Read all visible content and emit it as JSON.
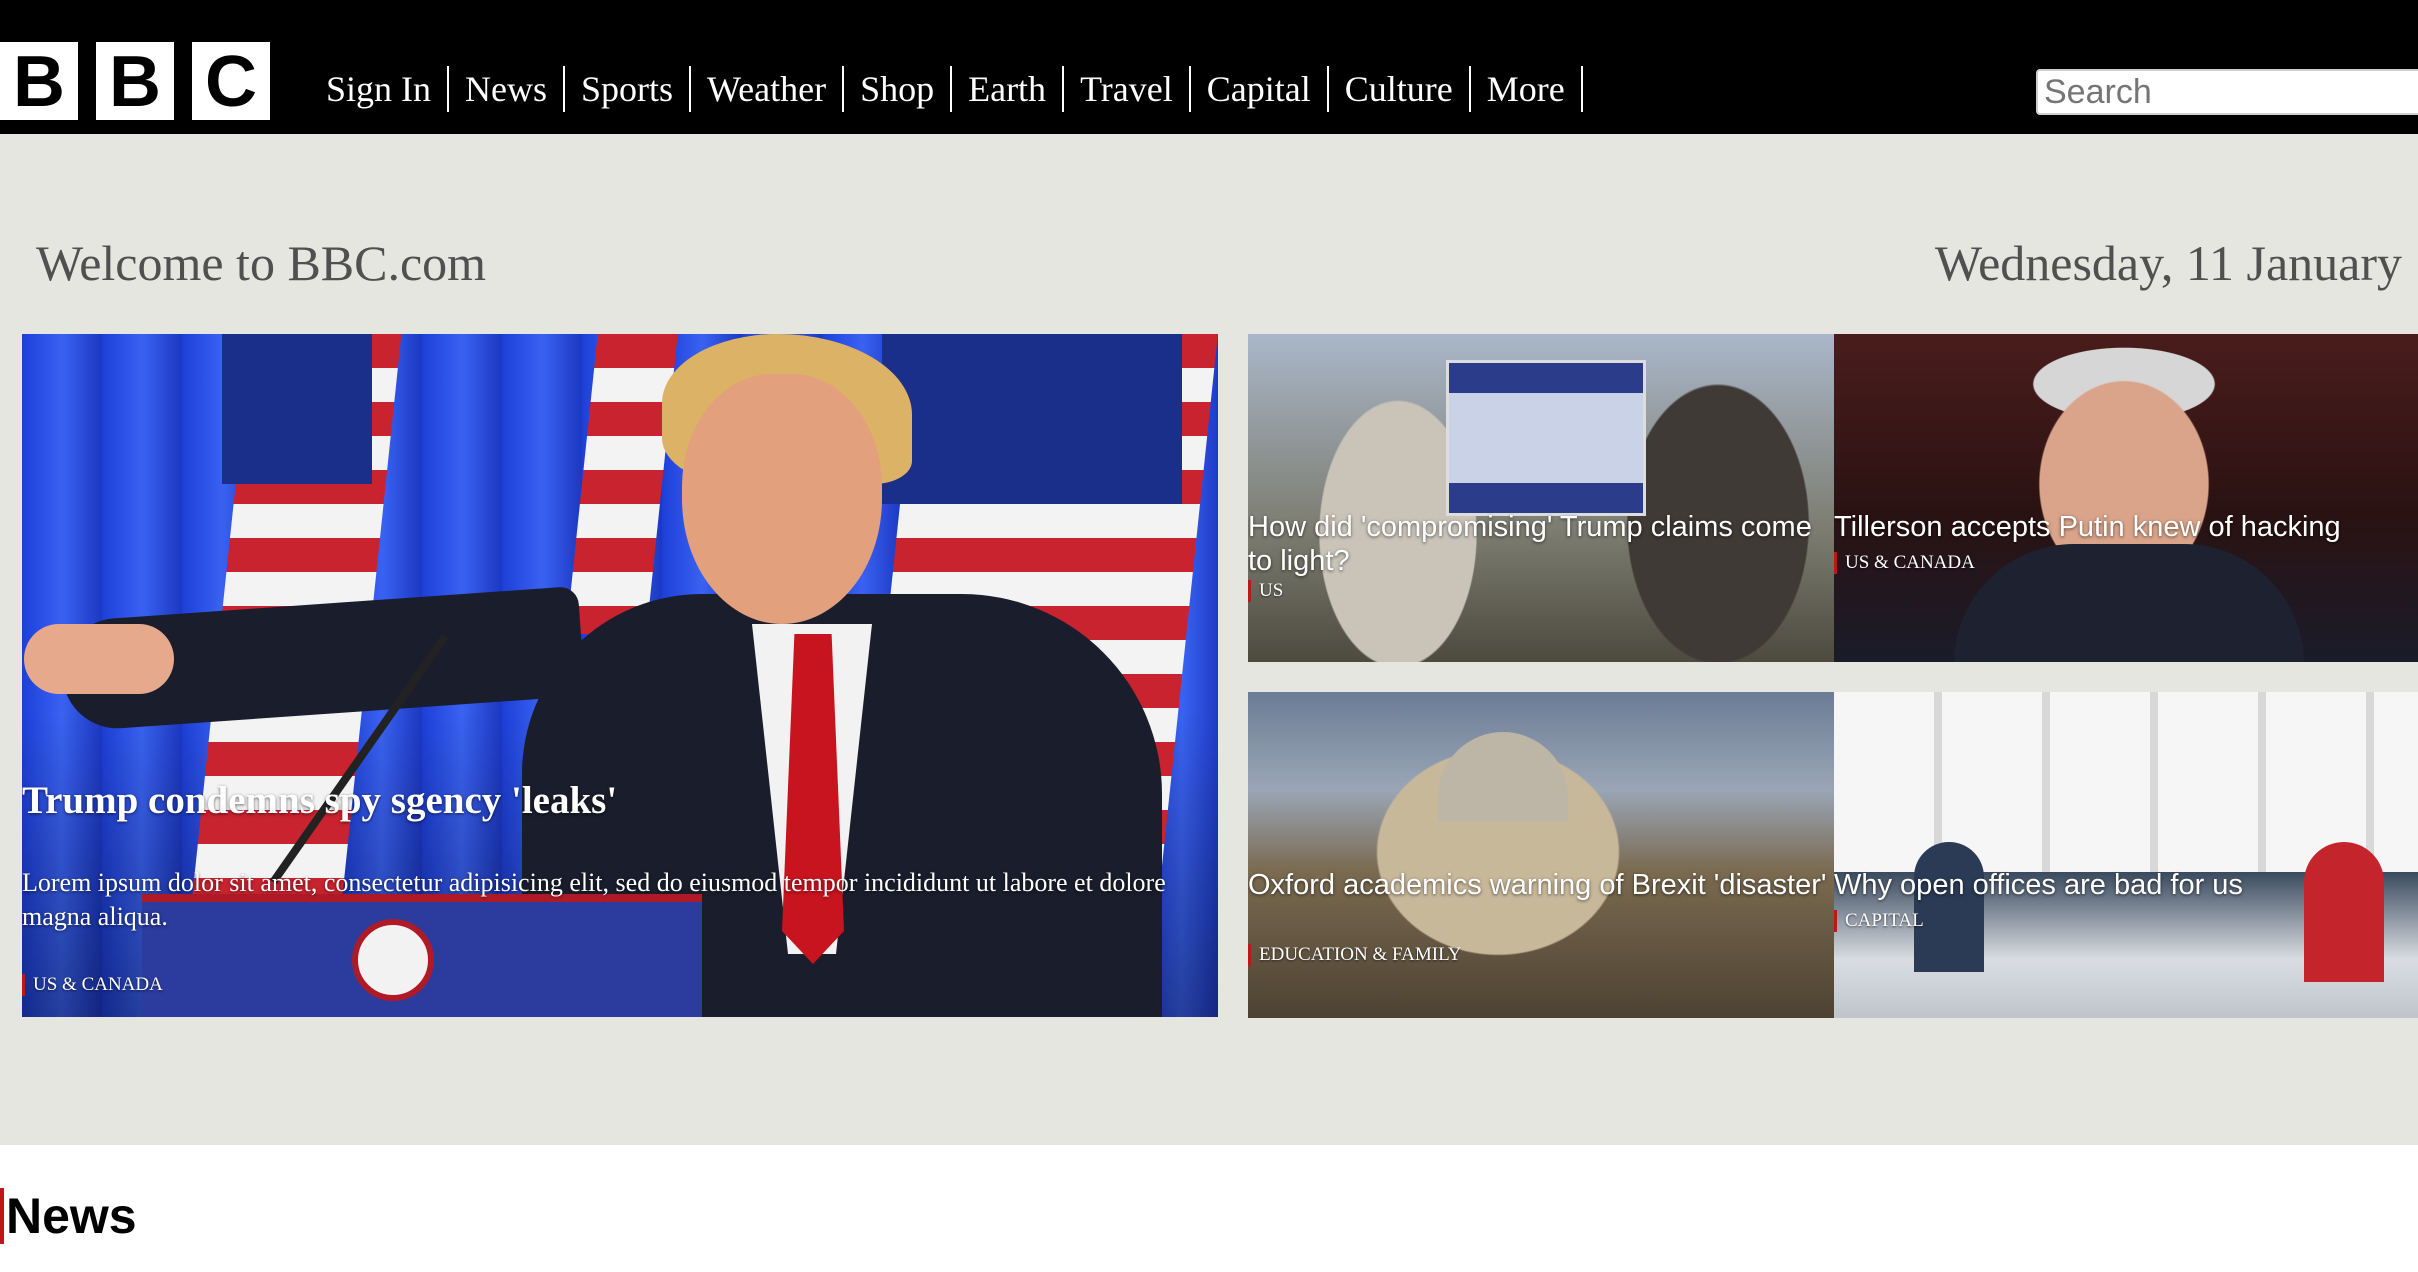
{
  "logo": {
    "letters": [
      "B",
      "B",
      "C"
    ]
  },
  "nav": {
    "items": [
      "Sign In",
      "News",
      "Sports",
      "Weather",
      "Shop",
      "Earth",
      "Travel",
      "Capital",
      "Culture",
      "More"
    ]
  },
  "search": {
    "placeholder": "Search",
    "value": ""
  },
  "hero": {
    "welcome": "Welcome to BBC.com",
    "date": "Wednesday, 11 January",
    "main_story": {
      "title": "Trump condemns spy sgency 'leaks'",
      "description": "Lorem ipsum dolor sit amet, consectetur adipisicing elit, sed do eiusmod tempor incididunt ut labore et dolore magna aliqua.",
      "tag": "US & CANADA"
    },
    "stories": [
      {
        "title": "How did 'compromising' Trump claims come to light?",
        "tag": "US"
      },
      {
        "title": "Tillerson accepts Putin knew of hacking",
        "tag": "US & CANADA"
      },
      {
        "title": "Oxford academics warning of Brexit 'disaster'",
        "tag": "EDUCATION & FAMILY"
      },
      {
        "title": "Why open offices are bad for us",
        "tag": "CAPITAL"
      }
    ]
  },
  "section": {
    "title": "News"
  },
  "colors": {
    "topbar": "#000000",
    "hero_background": "#e6e6e1",
    "accent": "#bb1919"
  }
}
